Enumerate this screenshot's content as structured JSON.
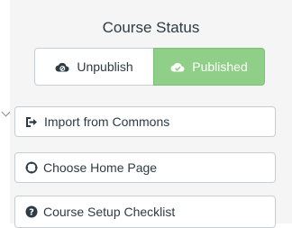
{
  "course_status": {
    "title": "Course Status",
    "unpublish_label": "Unpublish",
    "published_label": "Published",
    "unpublish_icon": "cloud-blocked-icon",
    "published_icon": "cloud-check-icon",
    "published_color": "#8fcf87"
  },
  "actions": {
    "import_label": "Import from Commons",
    "import_icon": "share-arrow-icon",
    "home_label": "Choose Home Page",
    "home_icon": "target-icon",
    "checklist_label": "Course Setup Checklist",
    "checklist_icon": "question-circle-icon"
  }
}
